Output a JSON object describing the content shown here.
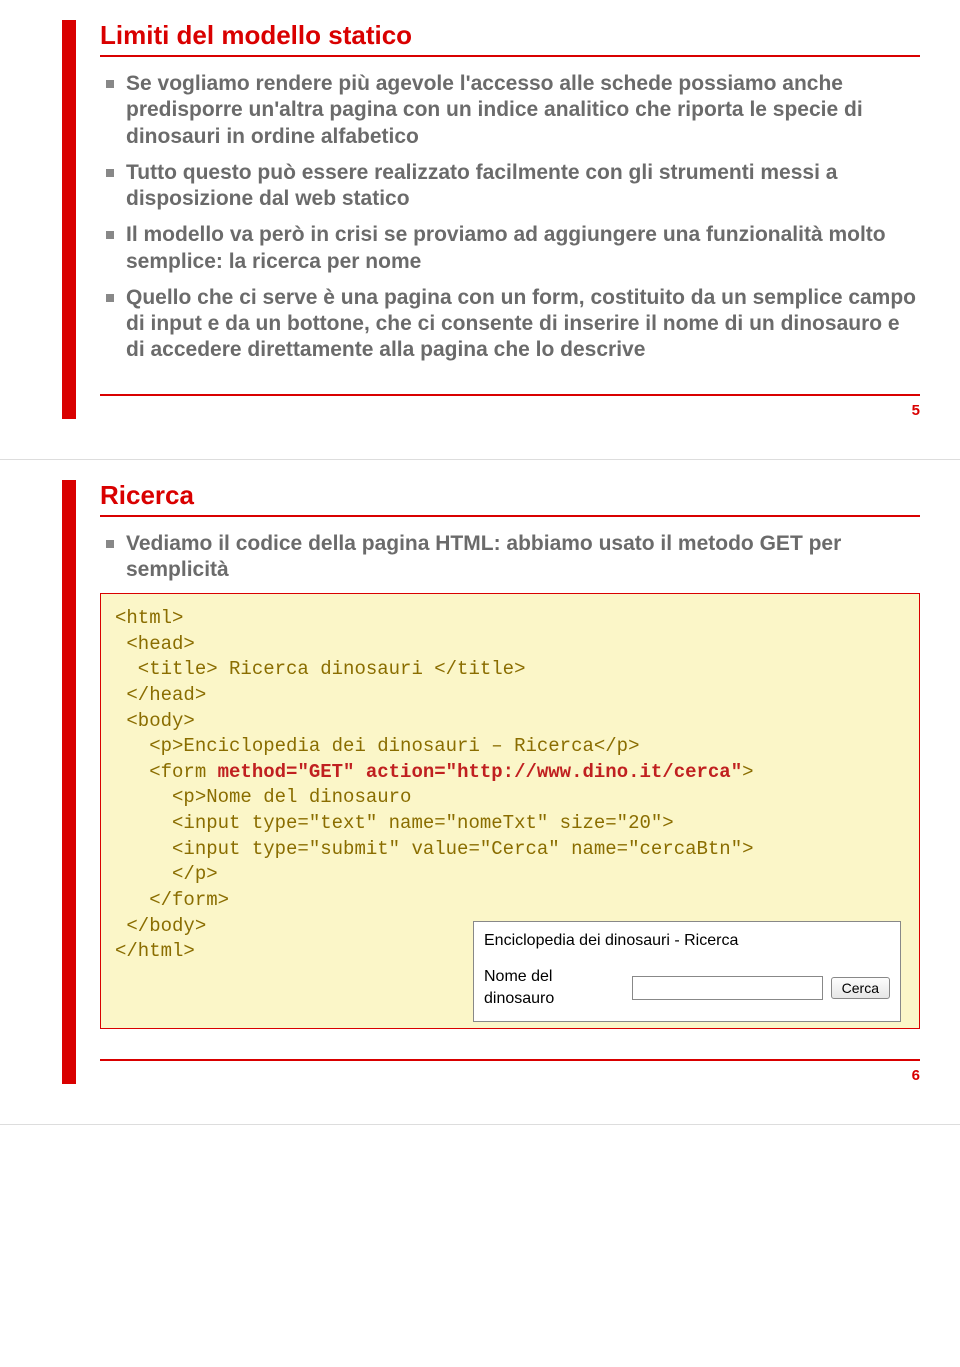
{
  "slide1": {
    "title": "Limiti del modello statico",
    "bullets": [
      "Se vogliamo rendere più agevole l'accesso alle schede possiamo anche predisporre un'altra pagina con un indice analitico che riporta le specie di dinosauri in ordine alfabetico",
      "Tutto questo può essere realizzato facilmente con gli strumenti messi a disposizione dal web statico",
      "Il modello va però in crisi se proviamo ad aggiungere una funzionalità molto semplice: la ricerca per nome",
      "Quello che ci serve è una pagina con un form, costituito da un semplice campo di input e da un bottone, che ci consente di inserire il nome di un dinosauro e di accedere direttamente alla pagina che lo descrive"
    ],
    "page": "5"
  },
  "slide2": {
    "title": "Ricerca",
    "bullets": [
      "Vediamo il codice della pagina HTML: abbiamo usato il metodo GET per semplicità"
    ],
    "code": {
      "l1": "<html>",
      "l2": " <head>",
      "l3": "  <title> Ricerca dinosauri </title>",
      "l4": " </head>",
      "l5": " <body>",
      "l6": "   <p>Enciclopedia dei dinosauri – Ricerca</p>",
      "l7a": "   <form ",
      "l7b": "method=\"GET\" action=\"http://www.dino.it/cerca\"",
      "l7c": ">",
      "l8": "     <p>Nome del dinosauro",
      "l9": "     <input type=\"text\" name=\"nomeTxt\" size=\"20\">",
      "l10": "     <input type=\"submit\" value=\"Cerca\" name=\"cercaBtn\">",
      "l11": "     </p>",
      "l12": "   </form>",
      "l13": " </body>",
      "l14": "</html>"
    },
    "preview": {
      "heading": "Enciclopedia dei dinosauri - Ricerca",
      "label": "Nome del dinosauro",
      "button": "Cerca"
    },
    "page": "6"
  }
}
